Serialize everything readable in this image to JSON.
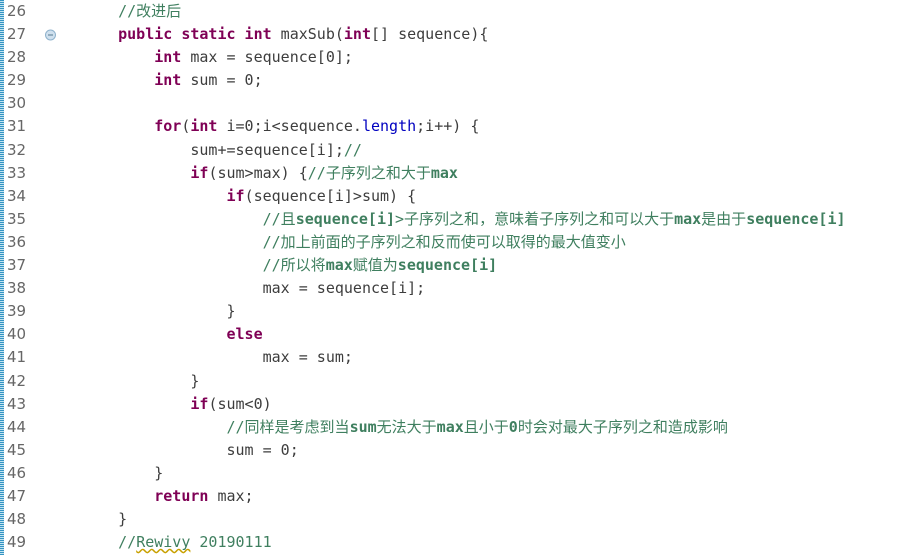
{
  "editor": {
    "name": "java-source-editor",
    "background_color": "#ffffff",
    "first_line_number": 26,
    "last_line_number": 49,
    "line_height_px": 23.1,
    "font_size_px": 15
  },
  "colors": {
    "keyword": "#7F0055",
    "comment": "#3F7F5F",
    "field": "#0000C0",
    "plain_text": "#3D3D3D",
    "line_number": "#666666",
    "fold_marker_fill": "#CFE0EE",
    "fold_marker_border": "#8FB2CC",
    "annotation_strip": "#2A8FC0",
    "spellcheck_underline": "#C8A000",
    "background": "#FFFFFF"
  },
  "gutter": {
    "name": "line-number-gutter",
    "line_numbers": [
      "26",
      "27",
      "28",
      "29",
      "30",
      "31",
      "32",
      "33",
      "34",
      "35",
      "36",
      "37",
      "38",
      "39",
      "40",
      "41",
      "42",
      "43",
      "44",
      "45",
      "46",
      "47",
      "48",
      "49"
    ],
    "fold_marker_on_line": "27",
    "fold_marker_icon": "collapse-minus-icon"
  },
  "lines": [
    {
      "number": "26",
      "text": "    //改进后",
      "tokens": [
        {
          "t": "    ",
          "c": "plain"
        },
        {
          "t": "//改进后",
          "c": "cmt"
        }
      ]
    },
    {
      "number": "27",
      "text": "    public static int maxSub(int[] sequence){",
      "tokens": [
        {
          "t": "    ",
          "c": "plain"
        },
        {
          "t": "public static int",
          "c": "kw"
        },
        {
          "t": " maxSub(",
          "c": "plain"
        },
        {
          "t": "int",
          "c": "kw"
        },
        {
          "t": "[] sequence){",
          "c": "plain"
        }
      ]
    },
    {
      "number": "28",
      "text": "        int max = sequence[0];",
      "tokens": [
        {
          "t": "        ",
          "c": "plain"
        },
        {
          "t": "int",
          "c": "kw"
        },
        {
          "t": " max = sequence[0];",
          "c": "plain"
        }
      ]
    },
    {
      "number": "29",
      "text": "        int sum = 0;",
      "tokens": [
        {
          "t": "        ",
          "c": "plain"
        },
        {
          "t": "int",
          "c": "kw"
        },
        {
          "t": " sum = 0;",
          "c": "plain"
        }
      ]
    },
    {
      "number": "30",
      "text": "",
      "tokens": []
    },
    {
      "number": "31",
      "text": "        for(int i=0;i<sequence.length;i++) {",
      "tokens": [
        {
          "t": "        ",
          "c": "plain"
        },
        {
          "t": "for",
          "c": "kw"
        },
        {
          "t": "(",
          "c": "plain"
        },
        {
          "t": "int",
          "c": "kw"
        },
        {
          "t": " i=0;i<sequence.",
          "c": "plain"
        },
        {
          "t": "length",
          "c": "fld"
        },
        {
          "t": ";i++) {",
          "c": "plain"
        }
      ]
    },
    {
      "number": "32",
      "text": "            sum+=sequence[i];//",
      "tokens": [
        {
          "t": "            sum+=sequence[i];",
          "c": "plain"
        },
        {
          "t": "//",
          "c": "cmt"
        }
      ]
    },
    {
      "number": "33",
      "text": "            if(sum>max) {//子序列之和大于max",
      "tokens": [
        {
          "t": "            ",
          "c": "plain"
        },
        {
          "t": "if",
          "c": "kw"
        },
        {
          "t": "(sum>max) {",
          "c": "plain"
        },
        {
          "t": "//子序列之和大于",
          "c": "cmt"
        },
        {
          "t": "max",
          "c": "cmt-b"
        }
      ]
    },
    {
      "number": "34",
      "text": "                if(sequence[i]>sum) {",
      "tokens": [
        {
          "t": "                ",
          "c": "plain"
        },
        {
          "t": "if",
          "c": "kw"
        },
        {
          "t": "(sequence[i]>sum) {",
          "c": "plain"
        }
      ]
    },
    {
      "number": "35",
      "text": "                    //且sequence[i]>子序列之和，意味着子序列之和可以大于max是由于sequence[i]",
      "tokens": [
        {
          "t": "                    ",
          "c": "plain"
        },
        {
          "t": "//且",
          "c": "cmt"
        },
        {
          "t": "sequence[i]",
          "c": "cmt-b"
        },
        {
          "t": ">子序列之和，意味着子序列之和可以大于",
          "c": "cmt"
        },
        {
          "t": "max",
          "c": "cmt-b"
        },
        {
          "t": "是由于",
          "c": "cmt"
        },
        {
          "t": "sequence[i]",
          "c": "cmt-b"
        }
      ]
    },
    {
      "number": "36",
      "text": "                    //加上前面的子序列之和反而使可以取得的最大值变小",
      "tokens": [
        {
          "t": "                    ",
          "c": "plain"
        },
        {
          "t": "//加上前面的子序列之和反而使可以取得的最大值变小",
          "c": "cmt"
        }
      ]
    },
    {
      "number": "37",
      "text": "                    //所以将max赋值为sequence[i]",
      "tokens": [
        {
          "t": "                    ",
          "c": "plain"
        },
        {
          "t": "//所以将",
          "c": "cmt"
        },
        {
          "t": "max",
          "c": "cmt-b"
        },
        {
          "t": "赋值为",
          "c": "cmt"
        },
        {
          "t": "sequence[i]",
          "c": "cmt-b"
        }
      ]
    },
    {
      "number": "38",
      "text": "                    max = sequence[i];",
      "tokens": [
        {
          "t": "                    max = sequence[i];",
          "c": "plain"
        }
      ]
    },
    {
      "number": "39",
      "text": "                }",
      "tokens": [
        {
          "t": "                }",
          "c": "plain"
        }
      ]
    },
    {
      "number": "40",
      "text": "                else",
      "tokens": [
        {
          "t": "                ",
          "c": "plain"
        },
        {
          "t": "else",
          "c": "kw"
        }
      ]
    },
    {
      "number": "41",
      "text": "                    max = sum;",
      "tokens": [
        {
          "t": "                    max = sum;",
          "c": "plain"
        }
      ]
    },
    {
      "number": "42",
      "text": "            }",
      "tokens": [
        {
          "t": "            }",
          "c": "plain"
        }
      ]
    },
    {
      "number": "43",
      "text": "            if(sum<0)",
      "tokens": [
        {
          "t": "            ",
          "c": "plain"
        },
        {
          "t": "if",
          "c": "kw"
        },
        {
          "t": "(sum<0)",
          "c": "plain"
        }
      ]
    },
    {
      "number": "44",
      "text": "                //同样是考虑到当sum无法大于max且小于0时会对最大子序列之和造成影响",
      "tokens": [
        {
          "t": "                ",
          "c": "plain"
        },
        {
          "t": "//同样是考虑到当",
          "c": "cmt"
        },
        {
          "t": "sum",
          "c": "cmt-b"
        },
        {
          "t": "无法大于",
          "c": "cmt"
        },
        {
          "t": "max",
          "c": "cmt-b"
        },
        {
          "t": "且小于",
          "c": "cmt"
        },
        {
          "t": "0",
          "c": "cmt-b"
        },
        {
          "t": "时会对最大子序列之和造成影响",
          "c": "cmt"
        }
      ]
    },
    {
      "number": "45",
      "text": "                sum = 0;",
      "tokens": [
        {
          "t": "                sum = 0;",
          "c": "plain"
        }
      ]
    },
    {
      "number": "46",
      "text": "        }",
      "tokens": [
        {
          "t": "        }",
          "c": "plain"
        }
      ]
    },
    {
      "number": "47",
      "text": "        return max;",
      "tokens": [
        {
          "t": "        ",
          "c": "plain"
        },
        {
          "t": "return",
          "c": "kw"
        },
        {
          "t": " max;",
          "c": "plain"
        }
      ]
    },
    {
      "number": "48",
      "text": "    }",
      "tokens": [
        {
          "t": "    }",
          "c": "plain"
        }
      ]
    },
    {
      "number": "49",
      "text": "    //Rewivy 20190111",
      "tokens": [
        {
          "t": "    ",
          "c": "plain"
        },
        {
          "t": "//",
          "c": "cmt"
        },
        {
          "t": "Rewivy",
          "c": "cmt spell"
        },
        {
          "t": " 20190111",
          "c": "cmt"
        }
      ]
    }
  ]
}
